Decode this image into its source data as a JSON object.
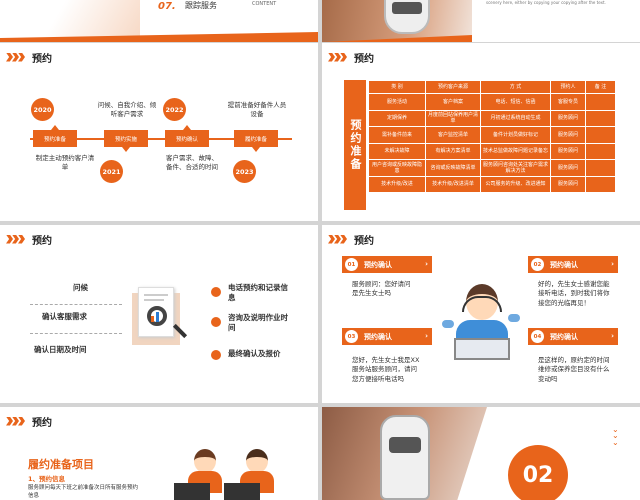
{
  "top_left": {
    "num": "07.",
    "title": "跟踪服务",
    "sub": "CONTENT"
  },
  "top_right": {
    "caption": "scenery here, either by copying your copying after the text."
  },
  "header_title": "预约",
  "timeline": {
    "years": [
      "2020",
      "2021",
      "2022",
      "2023"
    ],
    "tags": [
      "预约准备",
      "预约实施",
      "预约确认",
      "履约准备"
    ],
    "texts": [
      "制定主动预约客户清单",
      "问候、自我介绍、倾听客户需求",
      "客户需求、故障、备件、合适的时间",
      "提前准备好备件人员设备"
    ]
  },
  "table": {
    "side_label": "预约准备",
    "headers": [
      "类 别",
      "预约客户来源",
      "方 式",
      "预约人",
      "备 注"
    ],
    "rows": [
      [
        "服务活动",
        "客户档案",
        "电话、短信、信函",
        "客服专员",
        ""
      ],
      [
        "定期保养",
        "月度前回站保养用户清单",
        "月初通过系统自动生成",
        "服务顾问",
        ""
      ],
      [
        "需补备件前来",
        "客户监控清单",
        "备件计划员做好标记",
        "服务顾问",
        ""
      ],
      [
        "未解决故障",
        "有解决方案清单",
        "技术总监做故障问题记录备忘",
        "服务顾问",
        ""
      ],
      [
        "用户咨询或反映故障隐患",
        "咨询或反映故障清单",
        "服务顾问咨询处关注客户需求解决方法",
        "服务顾问",
        ""
      ],
      [
        "技术升级/改进",
        "技术升级/改进清单",
        "公司服务的升级、改进通知",
        "服务顾问",
        ""
      ]
    ]
  },
  "left_items": [
    "问候",
    "确认客服需求",
    "确认日期及时间"
  ],
  "right_items": [
    "电话预约和记录信息",
    "咨询及说明作业时间",
    "最终确认及报价"
  ],
  "cards": [
    {
      "num": "01",
      "title": "预约确认",
      "text": "服务顾问：您好请问是先生女士吗"
    },
    {
      "num": "02",
      "title": "预约确认",
      "text": "好的，先生女士感谢您能接听电话，到时我们将你接您的光临再见！"
    },
    {
      "num": "03",
      "title": "预约确认",
      "text": "您好，先生女士我是XX服务站服务顾问，请问您方便接听电话吗"
    },
    {
      "num": "04",
      "title": "预约确认",
      "text": "是这样的，原约定的时间维修或保养您目没有什么变动吗"
    }
  ],
  "bottom_left": {
    "title": "履约准备项目",
    "sub": "1、预约信息",
    "text": "服务顾问每天下班之前准备次日所有服务预约信息"
  },
  "bottom_right": {
    "num": "02"
  },
  "colors": {
    "accent": "#e8641b"
  }
}
